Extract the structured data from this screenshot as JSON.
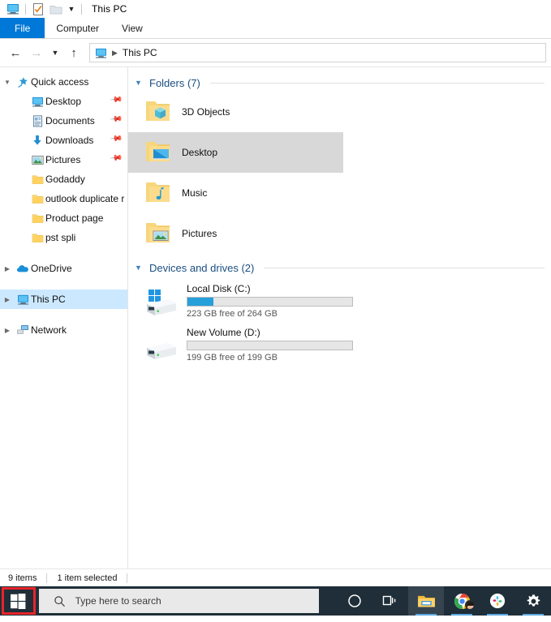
{
  "window": {
    "title": "This PC",
    "quick_access_toolbar": [
      {
        "name": "this-pc-icon",
        "label": "This PC"
      },
      {
        "name": "properties-icon",
        "label": "Properties"
      },
      {
        "name": "new-folder-icon",
        "label": "New folder"
      }
    ],
    "customize_label": "Customize Quick Access Toolbar"
  },
  "ribbon": {
    "tabs": [
      {
        "label": "File",
        "active": true
      },
      {
        "label": "Computer",
        "active": false
      },
      {
        "label": "View",
        "active": false
      }
    ]
  },
  "navigation": {
    "back_label": "Back",
    "forward_label": "Forward",
    "recent_label": "Recent locations",
    "up_label": "Up",
    "breadcrumb": "This PC",
    "breadcrumb_icon": "this-pc-icon"
  },
  "sidebar": {
    "items": [
      {
        "label": "Quick access",
        "icon": "star-pin-icon",
        "arrow": "expanded",
        "indent": 0,
        "pinned": false,
        "selected": false
      },
      {
        "label": "Desktop",
        "icon": "desktop-icon",
        "arrow": "none",
        "indent": 1,
        "pinned": true,
        "selected": false
      },
      {
        "label": "Documents",
        "icon": "documents-icon",
        "arrow": "none",
        "indent": 1,
        "pinned": true,
        "selected": false
      },
      {
        "label": "Downloads",
        "icon": "downloads-icon",
        "arrow": "none",
        "indent": 1,
        "pinned": true,
        "selected": false
      },
      {
        "label": "Pictures",
        "icon": "pictures-icon",
        "arrow": "none",
        "indent": 1,
        "pinned": true,
        "selected": false
      },
      {
        "label": "Godaddy",
        "icon": "folder-icon",
        "arrow": "none",
        "indent": 1,
        "pinned": false,
        "selected": false
      },
      {
        "label": "outlook  duplicate r",
        "icon": "folder-icon",
        "arrow": "none",
        "indent": 1,
        "pinned": false,
        "selected": false
      },
      {
        "label": "Product page",
        "icon": "folder-icon",
        "arrow": "none",
        "indent": 1,
        "pinned": false,
        "selected": false
      },
      {
        "label": "pst spli",
        "icon": "folder-icon",
        "arrow": "none",
        "indent": 1,
        "pinned": false,
        "selected": false
      },
      {
        "label": "OneDrive",
        "icon": "onedrive-icon",
        "arrow": "collapsed",
        "indent": 0,
        "pinned": false,
        "selected": false
      },
      {
        "label": "This PC",
        "icon": "this-pc-icon",
        "arrow": "collapsed",
        "indent": 0,
        "pinned": false,
        "selected": true
      },
      {
        "label": "Network",
        "icon": "network-icon",
        "arrow": "collapsed",
        "indent": 0,
        "pinned": false,
        "selected": false
      }
    ]
  },
  "content": {
    "groups": [
      {
        "title": "Folders (7)",
        "expanded": true,
        "items": [
          {
            "label": "3D Objects",
            "icon": "folder-3d-objects-icon",
            "selected": false
          },
          {
            "label": "Desktop",
            "icon": "folder-desktop-icon",
            "selected": true
          },
          {
            "label": "Music",
            "icon": "folder-music-icon",
            "selected": false
          },
          {
            "label": "Pictures",
            "icon": "folder-pictures-icon",
            "selected": false
          }
        ]
      },
      {
        "title": "Devices and drives (2)",
        "expanded": true,
        "drives": [
          {
            "label": "Local Disk (C:)",
            "icon": "windows-drive-icon",
            "free_text": "223 GB free of 264 GB",
            "used_percent": 16,
            "bar_color": "#26a0da"
          },
          {
            "label": "New Volume (D:)",
            "icon": "drive-icon",
            "free_text": "199 GB free of 199 GB",
            "used_percent": 0,
            "bar_color": "#26a0da"
          }
        ]
      }
    ]
  },
  "statusbar": {
    "item_count": "9 items",
    "selection": "1 item selected"
  },
  "taskbar": {
    "start_label": "Start",
    "start_highlight_color": "#e8252a",
    "search_placeholder": "Type here to search",
    "search_icon": "search-icon",
    "buttons": [
      {
        "name": "cortana-icon",
        "label": "Cortana"
      },
      {
        "name": "task-view-icon",
        "label": "Task View"
      },
      {
        "name": "file-explorer-icon",
        "label": "File Explorer",
        "active": true
      },
      {
        "name": "chrome-icon",
        "label": "Google Chrome",
        "active": true
      },
      {
        "name": "slack-icon",
        "label": "Slack",
        "active": true
      },
      {
        "name": "settings-gear-icon",
        "label": "Settings",
        "active": true
      }
    ]
  },
  "colors": {
    "accent": "#0078d7",
    "selection": "#cce8ff",
    "group_header": "#1a4f82",
    "taskbar": "#1f2e38"
  }
}
